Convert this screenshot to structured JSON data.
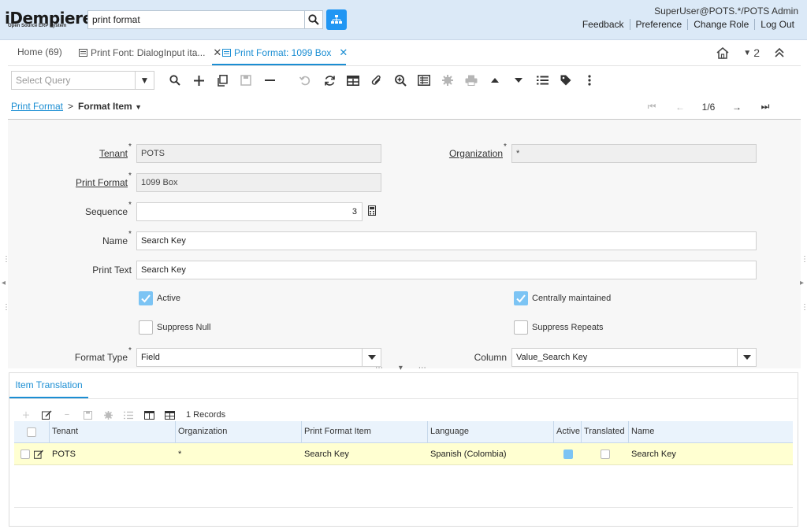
{
  "header": {
    "logo_name": "iDempiere",
    "logo_sub": "Open Source ERP System",
    "search_value": "print format",
    "user": "SuperUser@POTS.*/POTS Admin",
    "links": [
      "Feedback",
      "Preference",
      "Change Role",
      "Log Out"
    ]
  },
  "tabs": [
    {
      "label": "Home (69)"
    },
    {
      "label": "Print Font: DialogInput ita..."
    },
    {
      "label": "Print Format: 1099 Box"
    }
  ],
  "tab_right": {
    "count": "2"
  },
  "toolbar": {
    "query_placeholder": "Select Query"
  },
  "breadcrumb": {
    "parent": "Print Format",
    "separator": ">",
    "current": "Format Item"
  },
  "nav": {
    "position": "1/6"
  },
  "form": {
    "tenant_label": "Tenant",
    "tenant_value": "POTS",
    "org_label": "Organization",
    "org_value": "*",
    "printformat_label": "Print Format",
    "printformat_value": "1099 Box",
    "sequence_label": "Sequence",
    "sequence_value": "3",
    "name_label": "Name",
    "name_value": "Search Key",
    "printtext_label": "Print Text",
    "printtext_value": "Search Key",
    "active_label": "Active",
    "active": true,
    "central_label": "Centrally maintained",
    "central": true,
    "suppressnull_label": "Suppress Null",
    "suppressnull": false,
    "suppressrepeats_label": "Suppress Repeats",
    "suppressrepeats": false,
    "formattype_label": "Format Type",
    "formattype_value": "Field",
    "column_label": "Column",
    "column_value": "Value_Search Key"
  },
  "detail": {
    "tab_label": "Item Translation",
    "records": "1 Records",
    "columns": [
      "Tenant",
      "Organization",
      "Print Format Item",
      "Language",
      "Active",
      "Translated",
      "Name"
    ],
    "row": {
      "tenant": "POTS",
      "organization": "*",
      "item": "Search Key",
      "language": "Spanish (Colombia)",
      "active": true,
      "translated": false,
      "name": "Search Key"
    }
  },
  "colors": {
    "accent": "#1b8ed3",
    "header_bg": "#dbe9f7",
    "selected_row": "#ffffd1",
    "check_on": "#7cc4f4"
  }
}
